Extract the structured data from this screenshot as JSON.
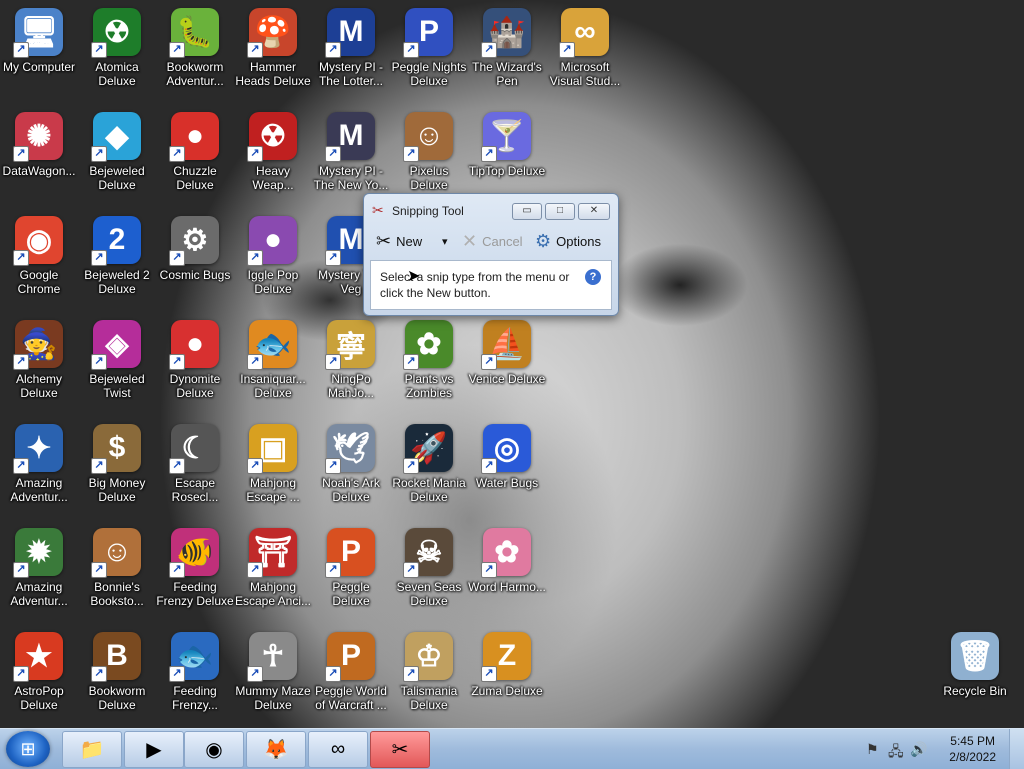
{
  "desktop": {
    "icons": [
      {
        "label": "My Computer",
        "art": "computer-icon",
        "glyph": "🖥",
        "bg": "#4b82c9"
      },
      {
        "label": "Atomica Deluxe",
        "art": "atomica-icon",
        "glyph": "☢",
        "bg": "#1e7d2a"
      },
      {
        "label": "Bookworm Adventur...",
        "art": "bookworm-adventures-icon",
        "glyph": "🐛",
        "bg": "#6ab23b"
      },
      {
        "label": "Hammer Heads Deluxe",
        "art": "hammer-heads-icon",
        "glyph": "🍄",
        "bg": "#c8452b"
      },
      {
        "label": "Mystery PI - The Lotter...",
        "art": "mystery-pi-lottery-icon",
        "glyph": "M",
        "bg": "#1d3f95"
      },
      {
        "label": "Peggle Nights Deluxe",
        "art": "peggle-nights-icon",
        "glyph": "P",
        "bg": "#3050c0"
      },
      {
        "label": "The Wizard's Pen",
        "art": "wizards-pen-icon",
        "glyph": "🏰",
        "bg": "#35507a"
      },
      {
        "label": "Microsoft Visual Stud...",
        "art": "visual-studio-icon",
        "glyph": "∞",
        "bg": "#d9a33a"
      },
      {
        "label": "DataWagon...",
        "art": "datawagon-icon",
        "glyph": "✺",
        "bg": "#c93a4a"
      },
      {
        "label": "Bejeweled Deluxe",
        "art": "bejeweled-icon",
        "glyph": "◆",
        "bg": "#2aa3d8"
      },
      {
        "label": "Chuzzle Deluxe",
        "art": "chuzzle-icon",
        "glyph": "●",
        "bg": "#d8302a"
      },
      {
        "label": "Heavy Weap...",
        "art": "heavy-weapon-icon",
        "glyph": "☢",
        "bg": "#c02020"
      },
      {
        "label": "Mystery PI - The New Yo...",
        "art": "mystery-pi-new-york-icon",
        "glyph": "M",
        "bg": "#3a3a55"
      },
      {
        "label": "Pixelus Deluxe",
        "art": "pixelus-icon",
        "glyph": "☺",
        "bg": "#a06a3a"
      },
      {
        "label": "TipTop Deluxe",
        "art": "tiptop-icon",
        "glyph": "🍸",
        "bg": "#6a6ae0"
      },
      {
        "label": "",
        "art": "",
        "glyph": "",
        "bg": ""
      },
      {
        "label": "Google Chrome",
        "art": "chrome-icon",
        "glyph": "◉",
        "bg": "#e0452f"
      },
      {
        "label": "Bejeweled 2 Deluxe",
        "art": "bejeweled-2-icon",
        "glyph": "2",
        "bg": "#1d5fcf"
      },
      {
        "label": "Cosmic Bugs",
        "art": "cosmic-bugs-icon",
        "glyph": "⚙",
        "bg": "#6b6b6b"
      },
      {
        "label": "Iggle Pop Deluxe",
        "art": "iggle-pop-icon",
        "glyph": "●",
        "bg": "#8a4ab0"
      },
      {
        "label": "Mystery The Veg",
        "art": "mystery-vegas-icon",
        "glyph": "M",
        "bg": "#2050b0"
      },
      {
        "label": "",
        "art": "",
        "glyph": "",
        "bg": ""
      },
      {
        "label": "",
        "art": "",
        "glyph": "",
        "bg": ""
      },
      {
        "label": "",
        "art": "",
        "glyph": "",
        "bg": ""
      },
      {
        "label": "Alchemy Deluxe",
        "art": "alchemy-icon",
        "glyph": "🧙",
        "bg": "#7a3a20"
      },
      {
        "label": "Bejeweled Twist",
        "art": "bejeweled-twist-icon",
        "glyph": "◈",
        "bg": "#b52d9a"
      },
      {
        "label": "Dynomite Deluxe",
        "art": "dynomite-icon",
        "glyph": "●",
        "bg": "#d83030"
      },
      {
        "label": "Insaniquar... Deluxe",
        "art": "insaniquarium-icon",
        "glyph": "🐟",
        "bg": "#e08a20"
      },
      {
        "label": "NingPo MahJo...",
        "art": "ningpo-mahjong-icon",
        "glyph": "寧",
        "bg": "#c9a13a"
      },
      {
        "label": "Plants vs Zombies",
        "art": "plants-vs-zombies-icon",
        "glyph": "✿",
        "bg": "#4a8a2a"
      },
      {
        "label": "Venice Deluxe",
        "art": "venice-icon",
        "glyph": "⛵",
        "bg": "#c08020"
      },
      {
        "label": "",
        "art": "",
        "glyph": "",
        "bg": ""
      },
      {
        "label": "Amazing Adventur...",
        "art": "amazing-adventures-1-icon",
        "glyph": "✦",
        "bg": "#2a62b0"
      },
      {
        "label": "Big Money Deluxe",
        "art": "big-money-icon",
        "glyph": "$",
        "bg": "#8a6a3a"
      },
      {
        "label": "Escape Rosecl...",
        "art": "escape-rosecliff-icon",
        "glyph": "☾",
        "bg": "#555555"
      },
      {
        "label": "Mahjong Escape ...",
        "art": "mahjong-escape-icon",
        "glyph": "▣",
        "bg": "#d8a020"
      },
      {
        "label": "Noah's Ark Deluxe",
        "art": "noahs-ark-icon",
        "glyph": "🕊",
        "bg": "#7a8aa0"
      },
      {
        "label": "Rocket Mania Deluxe",
        "art": "rocket-mania-icon",
        "glyph": "🚀",
        "bg": "#1a2a3a"
      },
      {
        "label": "Water Bugs",
        "art": "water-bugs-icon",
        "glyph": "◎",
        "bg": "#2a5ad8"
      },
      {
        "label": "",
        "art": "",
        "glyph": "",
        "bg": ""
      },
      {
        "label": "Amazing Adventur...",
        "art": "amazing-adventures-2-icon",
        "glyph": "✹",
        "bg": "#3a7a3a"
      },
      {
        "label": "Bonnie's Booksto...",
        "art": "bonnies-bookstore-icon",
        "glyph": "☺",
        "bg": "#b0703a"
      },
      {
        "label": "Feeding Frenzy Deluxe",
        "art": "feeding-frenzy-icon",
        "glyph": "🐠",
        "bg": "#c0307a"
      },
      {
        "label": "Mahjong Escape Anci...",
        "art": "mahjong-escape-ancient-icon",
        "glyph": "⛩",
        "bg": "#c02a2a"
      },
      {
        "label": "Peggle Deluxe",
        "art": "peggle-icon",
        "glyph": "P",
        "bg": "#d85020"
      },
      {
        "label": "Seven Seas Deluxe",
        "art": "seven-seas-icon",
        "glyph": "☠",
        "bg": "#5a4a3a"
      },
      {
        "label": "Word Harmo...",
        "art": "word-harmony-icon",
        "glyph": "✿",
        "bg": "#e07aa0"
      },
      {
        "label": "",
        "art": "",
        "glyph": "",
        "bg": ""
      },
      {
        "label": "AstroPop Deluxe",
        "art": "astropop-icon",
        "glyph": "★",
        "bg": "#d83a20"
      },
      {
        "label": "Bookworm Deluxe",
        "art": "bookworm-icon",
        "glyph": "B",
        "bg": "#7a4a20"
      },
      {
        "label": "Feeding Frenzy...",
        "art": "feeding-frenzy-2-icon",
        "glyph": "🐟",
        "bg": "#2a6ac0"
      },
      {
        "label": "Mummy Maze Deluxe",
        "art": "mummy-maze-icon",
        "glyph": "☥",
        "bg": "#8a8a8a"
      },
      {
        "label": "Peggle World of Warcraft ...",
        "art": "peggle-wow-icon",
        "glyph": "P",
        "bg": "#c06a20"
      },
      {
        "label": "Talismania Deluxe",
        "art": "talismania-icon",
        "glyph": "♔",
        "bg": "#c0a060"
      },
      {
        "label": "Zuma Deluxe",
        "art": "zuma-icon",
        "glyph": "Z",
        "bg": "#d89020"
      },
      {
        "label": "",
        "art": "",
        "glyph": "",
        "bg": ""
      }
    ],
    "recycle_bin": {
      "label": "Recycle Bin",
      "glyph": "🗑",
      "bg": "#8fb0d0"
    }
  },
  "snipping_tool": {
    "title": "Snipping Tool",
    "minimize": "▭",
    "maximize": "□",
    "close": "✕",
    "new_label": "New",
    "dropdown_glyph": "▾",
    "cancel_label": "Cancel",
    "options_label": "Options",
    "message": "Select a snip type from the menu or click the New button.",
    "help_glyph": "?"
  },
  "taskbar": {
    "start_glyph": "⊞",
    "pinned": [
      {
        "name": "explorer",
        "glyph": "📁"
      },
      {
        "name": "media-player",
        "glyph": "▶"
      },
      {
        "name": "chrome",
        "glyph": "◉"
      },
      {
        "name": "firefox",
        "glyph": "🦊"
      },
      {
        "name": "visual-studio",
        "glyph": "∞"
      },
      {
        "name": "snipping-tool",
        "glyph": "✂"
      }
    ],
    "tray_icons": [
      "⚑",
      "🖧",
      "🔊"
    ],
    "time": "5:45 PM",
    "date": "2/8/2022"
  }
}
